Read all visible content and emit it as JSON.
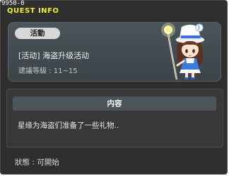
{
  "window": {
    "quest_id": "9950-0",
    "title": "QUEST INFO"
  },
  "quest": {
    "category": "活動",
    "name": "[活动] 海盗升级活动",
    "level_requirement": "建議等級 : 11~15",
    "npc_icon": "npc-girl-with-staff"
  },
  "content": {
    "header": "内容",
    "body": "星缘为海盗们准备了一些礼物.."
  },
  "status": {
    "text": "狀態 : 可開始"
  },
  "colors": {
    "title_yellow": "#f4e83a",
    "background": "#2f2f2f",
    "panel": "#4b555a"
  }
}
